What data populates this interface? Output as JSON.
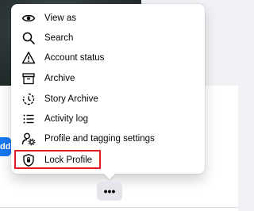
{
  "background": {
    "add_label": "Add"
  },
  "menu": {
    "items": [
      {
        "label": "View as",
        "icon": "eye-icon"
      },
      {
        "label": "Search",
        "icon": "search-icon"
      },
      {
        "label": "Account status",
        "icon": "warning-icon"
      },
      {
        "label": "Archive",
        "icon": "archive-box-icon"
      },
      {
        "label": "Story Archive",
        "icon": "story-archive-icon"
      },
      {
        "label": "Activity log",
        "icon": "list-icon"
      },
      {
        "label": "Profile and tagging settings",
        "icon": "profile-settings-icon"
      },
      {
        "label": "Lock Profile",
        "icon": "lock-shield-icon"
      }
    ],
    "highlighted_item": "Lock Profile",
    "highlight_color": "#e21b23"
  },
  "more_button": {
    "label": "•••"
  },
  "colors": {
    "brand_blue": "#1877f2",
    "menu_bg": "#ffffff",
    "page_bg": "#f0f2f5"
  }
}
